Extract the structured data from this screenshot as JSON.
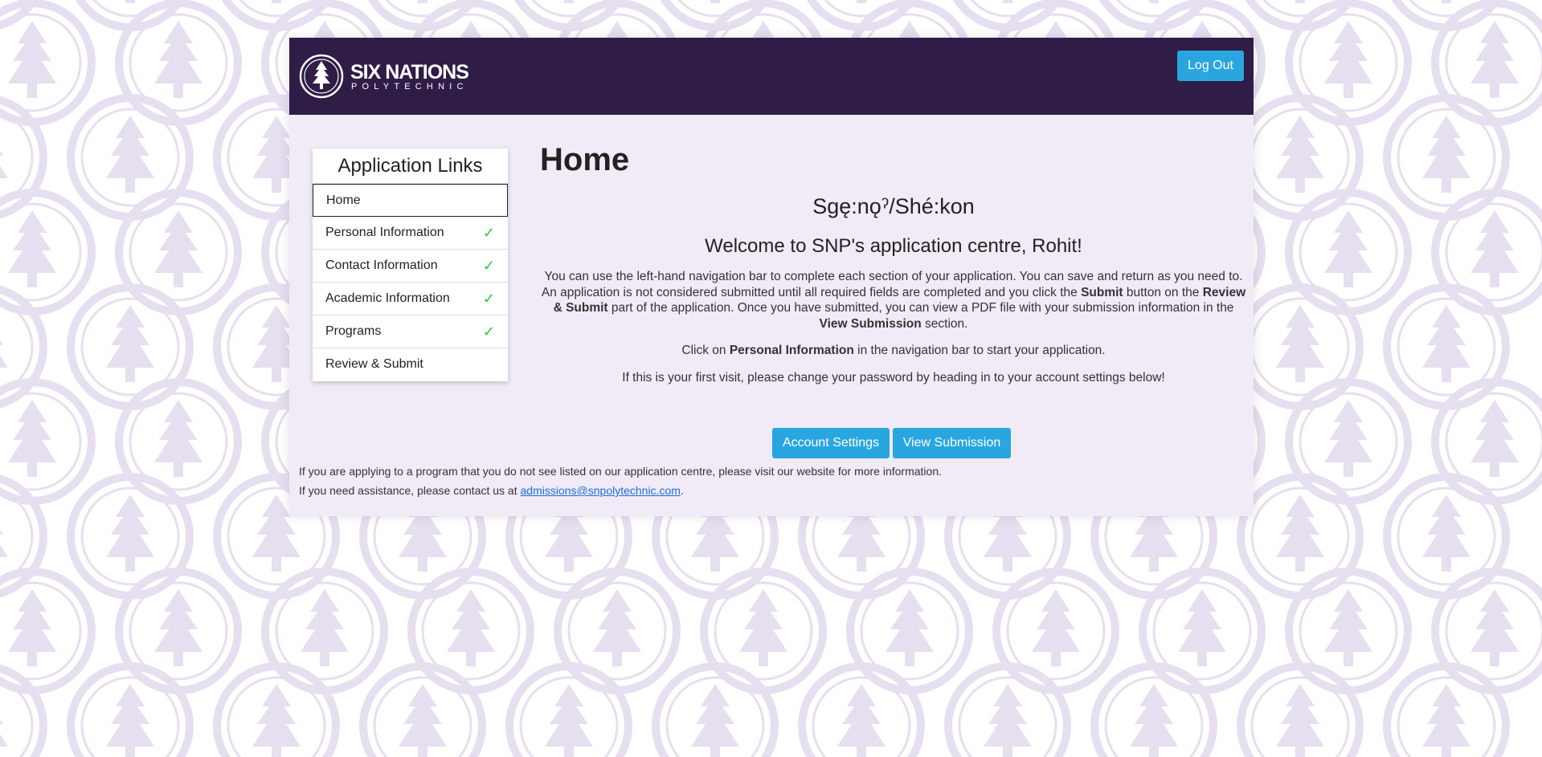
{
  "logo": {
    "line1": "SIX NATIONS",
    "line2": "POLYTECHNIC"
  },
  "header": {
    "logout_label": "Log Out"
  },
  "sidebar": {
    "title": "Application Links",
    "items": [
      {
        "label": "Home",
        "check": ""
      },
      {
        "label": "Personal Information",
        "check": "✓"
      },
      {
        "label": "Contact Information",
        "check": "✓"
      },
      {
        "label": "Academic Information",
        "check": "✓"
      },
      {
        "label": "Programs",
        "check": "✓"
      },
      {
        "label": "Review & Submit",
        "check": ""
      }
    ]
  },
  "main": {
    "title": "Home",
    "greeting": "Sgę:nǫˀ/Shé:kon",
    "welcome": "Welcome to SNP's application centre, Rohit!",
    "p1": {
      "a": "You can use the left-hand navigation bar to complete each section of your application. You can save and return as you need to. An application is not considered submitted until all required fields are completed and you click the ",
      "b": "Submit",
      "c": " button on the ",
      "d": "Review & Submit",
      "e": " part of the application. Once you have submitted, you can view a PDF file with your submission information in the ",
      "f": "View Submission",
      "g": " section."
    },
    "p2": {
      "a": "Click on ",
      "b": "Personal Information",
      "c": " in the navigation bar to start your application."
    },
    "p3": "If this is your first visit, please change your password by heading in to your account settings below!"
  },
  "buttons": {
    "account_settings": "Account Settings",
    "view_submission": "View Submission"
  },
  "footer": {
    "line1": "If you are applying to a program that you do not see listed on our application centre, please visit our website for more information.",
    "line2_prefix": "If you need assistance, please contact us at ",
    "email": "admissions@snpolytechnic.com",
    "line2_suffix": "."
  },
  "colors": {
    "header": "#2f1c47",
    "accent": "#29a6e0",
    "card": "#f0ebf6",
    "check": "#2ecc40"
  }
}
